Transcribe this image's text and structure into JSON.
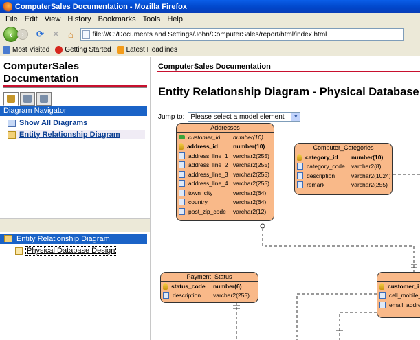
{
  "window": {
    "title": "ComputerSales Documentation - Mozilla Firefox"
  },
  "menu": [
    "File",
    "Edit",
    "View",
    "History",
    "Bookmarks",
    "Tools",
    "Help"
  ],
  "nav": {
    "url": "file:///C:/Documents and Settings/John/ComputerSales/report/html/index.html"
  },
  "bookmarks": [
    "Most Visited",
    "Getting Started",
    "Latest Headlines"
  ],
  "left": {
    "project_title": "ComputerSales Documentation",
    "navigator_header": "Diagram Navigator",
    "links": [
      "Show All Diagrams",
      "Entity Relationship Diagram"
    ],
    "tree_header": "Entity Relationship Diagram",
    "tree_item": "Physical Database Design"
  },
  "main": {
    "doc_title": "ComputerSales Documentation",
    "heading": "Entity Relationship Diagram - Physical Database D",
    "jump_label": "Jump to:",
    "jump_value": "Please select a model element"
  },
  "entities": {
    "addresses": {
      "title": "Addresses",
      "rows": [
        {
          "name": "customer_id",
          "type": "number(10)",
          "kind": "fk"
        },
        {
          "name": "address_id",
          "type": "number(10)",
          "kind": "pk"
        },
        {
          "name": "address_line_1",
          "type": "varchar2(255)",
          "kind": "col"
        },
        {
          "name": "address_line_2",
          "type": "varchar2(255)",
          "kind": "col"
        },
        {
          "name": "address_line_3",
          "type": "varchar2(255)",
          "kind": "col"
        },
        {
          "name": "address_line_4",
          "type": "varchar2(255)",
          "kind": "col"
        },
        {
          "name": "town_city",
          "type": "varchar2(64)",
          "kind": "col"
        },
        {
          "name": "country",
          "type": "varchar2(64)",
          "kind": "col"
        },
        {
          "name": "post_zip_code",
          "type": "varchar2(12)",
          "kind": "col"
        }
      ]
    },
    "computer_categories": {
      "title": "Computer_Categories",
      "rows": [
        {
          "name": "category_id",
          "type": "number(10)",
          "kind": "pk"
        },
        {
          "name": "category_code",
          "type": "varchar2(8)",
          "kind": "col"
        },
        {
          "name": "description",
          "type": "varchar2(1024)",
          "kind": "col"
        },
        {
          "name": "remark",
          "type": "varchar2(255)",
          "kind": "col"
        }
      ]
    },
    "payment_status": {
      "title": "Payment_Status",
      "rows": [
        {
          "name": "status_code",
          "type": "number(6)",
          "kind": "pk"
        },
        {
          "name": "description",
          "type": "varchar2(255)",
          "kind": "col"
        }
      ]
    },
    "customer": {
      "title": "",
      "rows": [
        {
          "name": "customer_i",
          "type": "",
          "kind": "pk"
        },
        {
          "name": "cell_mobile_",
          "type": "",
          "kind": "col"
        },
        {
          "name": "email_addre",
          "type": "",
          "kind": "col"
        }
      ]
    }
  }
}
